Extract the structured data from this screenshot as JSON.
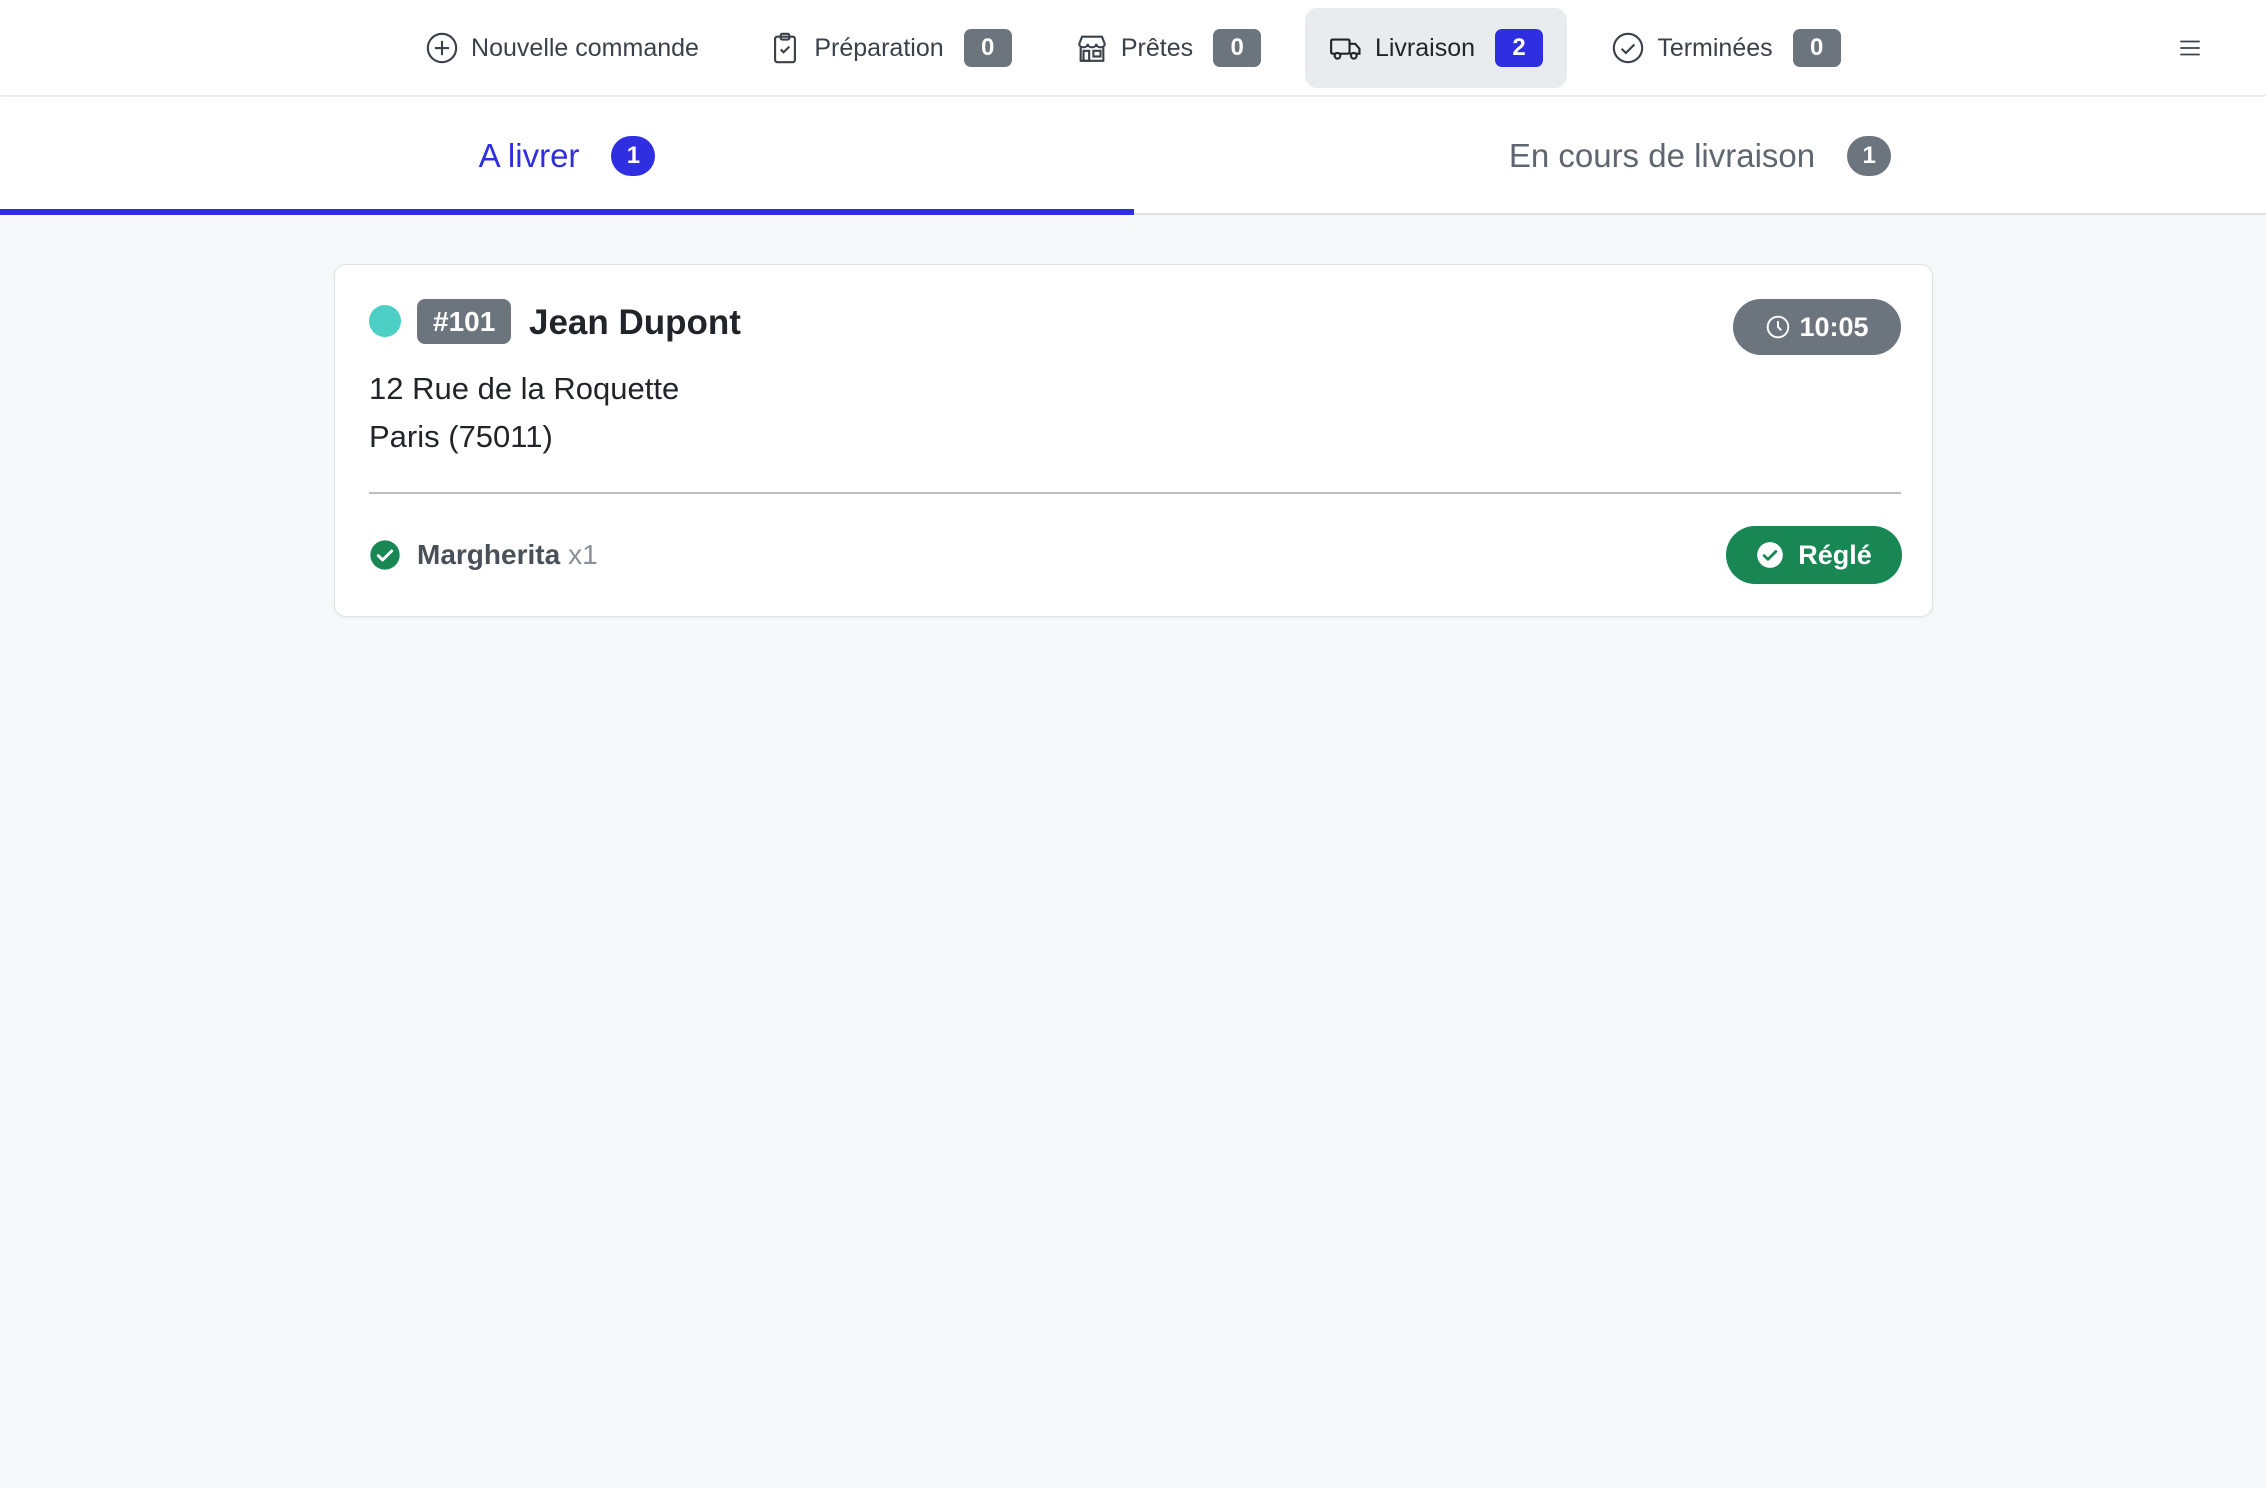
{
  "nav": {
    "items": [
      {
        "label": "Nouvelle commande",
        "icon": "plus-circle-icon"
      },
      {
        "label": "Préparation",
        "icon": "clipboard-check-icon",
        "count": "0"
      },
      {
        "label": "Prêtes",
        "icon": "shop-icon",
        "count": "0"
      },
      {
        "label": "Livraison",
        "icon": "truck-icon",
        "count": "2",
        "active": true
      },
      {
        "label": "Terminées",
        "icon": "check-circle-icon",
        "count": "0"
      }
    ],
    "menu_icon": "hamburger-menu-icon"
  },
  "subtabs": [
    {
      "label": "A livrer",
      "count": "1",
      "active": true
    },
    {
      "label": "En cours de livraison",
      "count": "1"
    }
  ],
  "order": {
    "status_color": "#4dcfc5",
    "number": "#101",
    "customer": "Jean Dupont",
    "time": "10:05",
    "address_line1": "12 Rue de la Roquette",
    "address_line2": "Paris (75011)",
    "items": [
      {
        "name": "Margherita",
        "qty": "x1"
      }
    ],
    "payment_status": "Réglé"
  },
  "colors": {
    "accent": "#2f2ee0",
    "secondary": "#6c757d",
    "success": "#198754",
    "background": "#f7f8fa"
  }
}
